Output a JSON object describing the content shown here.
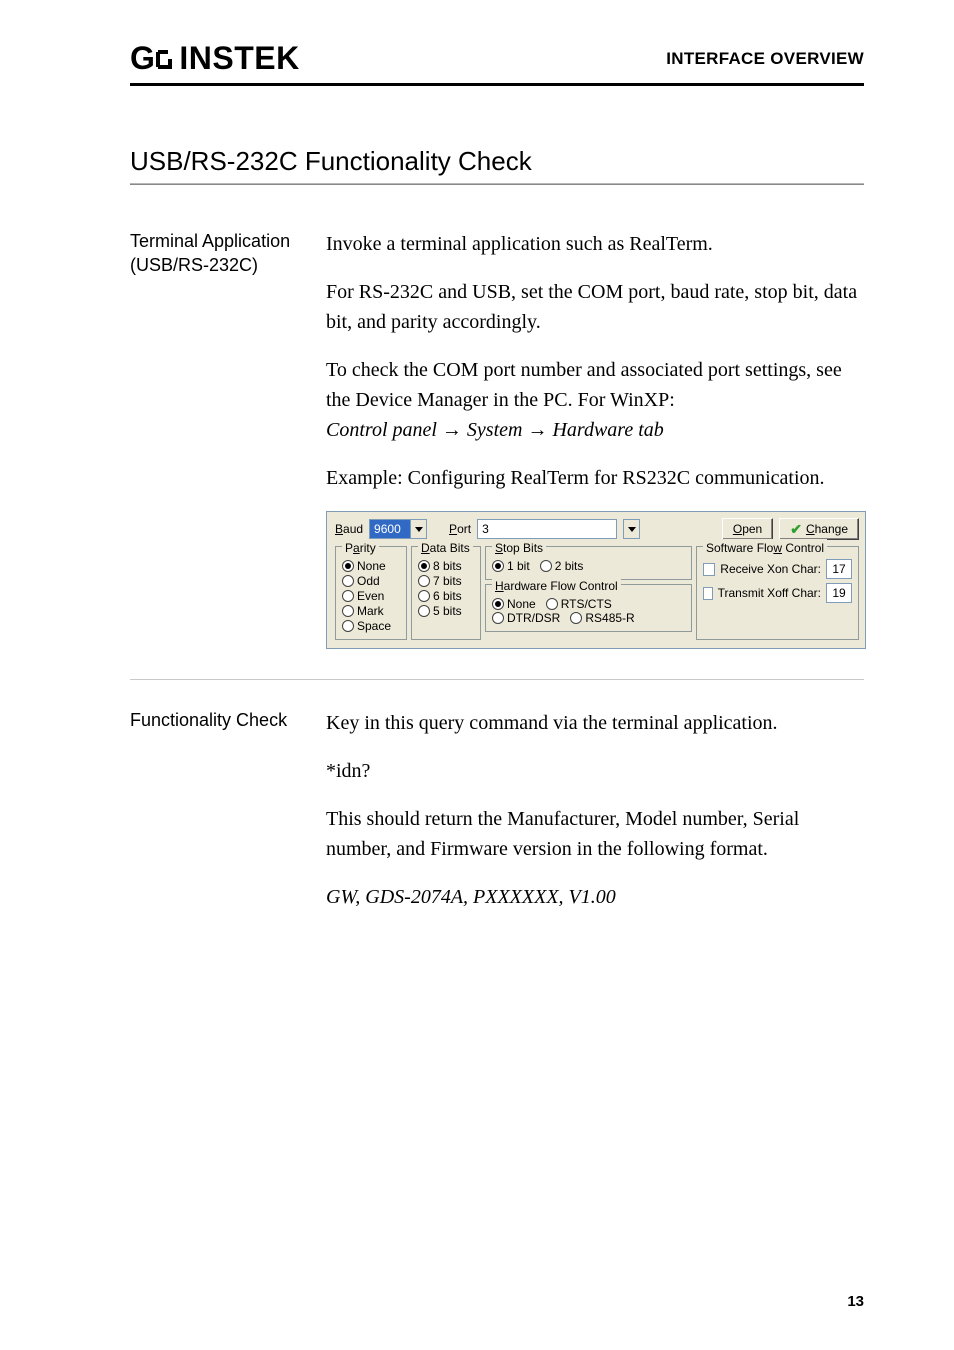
{
  "header": {
    "brand_pre": "G",
    "brand_post": "INSTEK",
    "right": "INTERFACE OVERVIEW"
  },
  "section_title": "USB/RS-232C Functionality Check",
  "block1": {
    "label": "Terminal Application (USB/RS-232C)",
    "p1": "Invoke a terminal application such as RealTerm.",
    "p2": "For RS-232C and USB, set the COM port, baud rate, stop bit, data bit, and parity accordingly.",
    "p3a": "To check the COM port number and associated port settings, see the Device Manager in the PC. For WinXP:",
    "p3b": "Control panel → System → Hardware tab",
    "p4": "Example: Configuring RealTerm for RS232C communication."
  },
  "rt": {
    "baud_label": "Baud",
    "baud_value": "9600",
    "port_label": "Port",
    "port_value": "3",
    "open_label": "Open",
    "change_label": "Change",
    "parity": {
      "legend": "Parity",
      "none": "None",
      "odd": "Odd",
      "even": "Even",
      "mark": "Mark",
      "space": "Space"
    },
    "databits": {
      "legend": "Data Bits",
      "b8": "8 bits",
      "b7": "7 bits",
      "b6": "6 bits",
      "b5": "5 bits"
    },
    "stopbits": {
      "legend": "Stop Bits",
      "s1": "1 bit",
      "s2": "2 bits"
    },
    "hwflow": {
      "legend": "Hardware Flow Control",
      "none": "None",
      "rtscts": "RTS/CTS",
      "dtrdsr": "DTR/DSR",
      "rs485": "RS485-R"
    },
    "swflow": {
      "legend": "Software Flow Control",
      "recv": "Receive Xon Char:",
      "recv_val": "17",
      "xmit": "Transmit Xoff Char:",
      "xmit_val": "19"
    }
  },
  "block2": {
    "label": "Functionality Check",
    "p1": "Key in this query command via the terminal application.",
    "p2": "*idn?",
    "p3": "This should return the Manufacturer, Model number, Serial number, and Firmware version in the following format.",
    "p4": "GW, GDS-2074A, PXXXXXX, V1.00"
  },
  "pagenum": "13"
}
